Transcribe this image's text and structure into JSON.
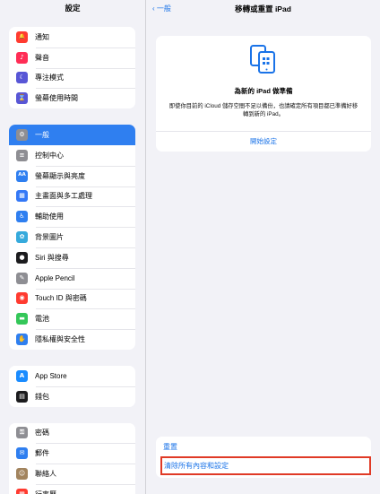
{
  "sidebar": {
    "title": "設定",
    "group1": [
      {
        "label": "通知",
        "icon": "bell-icon",
        "color": "#ff3b30",
        "glyph": "🔔"
      },
      {
        "label": "聲音",
        "icon": "speaker-icon",
        "color": "#ff2d55",
        "glyph": "♪"
      },
      {
        "label": "專注模式",
        "icon": "moon-icon",
        "color": "#5856d6",
        "glyph": "☾"
      },
      {
        "label": "螢幕使用時間",
        "icon": "hourglass-icon",
        "color": "#5856d6",
        "glyph": "⌛"
      }
    ],
    "group2": [
      {
        "label": "一般",
        "icon": "gear-icon",
        "color": "#8e8e93",
        "glyph": "⚙",
        "selected": true
      },
      {
        "label": "控制中心",
        "icon": "switches-icon",
        "color": "#8e8e93",
        "glyph": "≡"
      },
      {
        "label": "螢幕顯示與亮度",
        "icon": "text-size-icon",
        "color": "#2f7ff0",
        "glyph": "AA"
      },
      {
        "label": "主畫面與多工處理",
        "icon": "home-grid-icon",
        "color": "#3478f6",
        "glyph": "▦"
      },
      {
        "label": "輔助使用",
        "icon": "accessibility-icon",
        "color": "#2f7ff0",
        "glyph": "♿"
      },
      {
        "label": "背景圖片",
        "icon": "wallpaper-icon",
        "color": "#36aadc",
        "glyph": "✿"
      },
      {
        "label": "Siri 與搜尋",
        "icon": "siri-icon",
        "color": "#1c1c1e",
        "glyph": "●"
      },
      {
        "label": "Apple Pencil",
        "icon": "pencil-icon",
        "color": "#8e8e93",
        "glyph": "✎"
      },
      {
        "label": "Touch ID 與密碼",
        "icon": "fingerprint-icon",
        "color": "#ff3b30",
        "glyph": "◉"
      },
      {
        "label": "電池",
        "icon": "battery-icon",
        "color": "#34c759",
        "glyph": "▬"
      },
      {
        "label": "隱私權與安全性",
        "icon": "hand-icon",
        "color": "#2f7ff0",
        "glyph": "✋"
      }
    ],
    "group3": [
      {
        "label": "App Store",
        "icon": "app-store-icon",
        "color": "#1a8cff",
        "glyph": "A"
      },
      {
        "label": "錢包",
        "icon": "wallet-icon",
        "color": "#1c1c1e",
        "glyph": "▤"
      }
    ],
    "group4": [
      {
        "label": "密碼",
        "icon": "key-icon",
        "color": "#8e8e93",
        "glyph": "⚿"
      },
      {
        "label": "郵件",
        "icon": "mail-icon",
        "color": "#2f7ff0",
        "glyph": "✉"
      },
      {
        "label": "聯絡人",
        "icon": "contacts-icon",
        "color": "#a2845e",
        "glyph": "☺"
      },
      {
        "label": "行事曆",
        "icon": "calendar-icon",
        "color": "#ff3b30",
        "glyph": "▦"
      }
    ]
  },
  "main": {
    "back_label": "一般",
    "title": "移轉或重置 iPad",
    "card": {
      "heading": "為新的 iPad 做準備",
      "description": "即使你目前的 iCloud 儲存空間不足以備份，也請確定所有項目都已準備好移轉到新的 iPad。",
      "link": "開始設定"
    },
    "reset_label": "重置",
    "erase_label": "清除所有內容和設定"
  },
  "colors": {
    "accent": "#1a73e8",
    "selected_bg": "#2f7ff0",
    "highlight_box": "#e03a26"
  }
}
